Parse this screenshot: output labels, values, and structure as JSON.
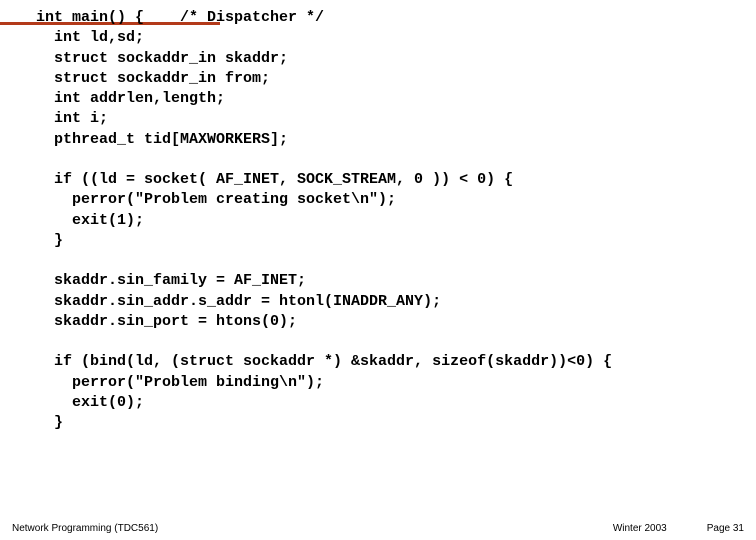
{
  "code": {
    "l1": "int main() {    /* Dispatcher */",
    "l2": "  int ld,sd;",
    "l3": "  struct sockaddr_in skaddr;",
    "l4": "  struct sockaddr_in from;",
    "l5": "  int addrlen,length;",
    "l6": "  int i;",
    "l7": "  pthread_t tid[MAXWORKERS];",
    "l8": "",
    "l9": "  if ((ld = socket( AF_INET, SOCK_STREAM, 0 )) < 0) {",
    "l10": "    perror(\"Problem creating socket\\n\");",
    "l11": "    exit(1);",
    "l12": "  }",
    "l13": "",
    "l14": "  skaddr.sin_family = AF_INET;",
    "l15": "  skaddr.sin_addr.s_addr = htonl(INADDR_ANY);",
    "l16": "  skaddr.sin_port = htons(0);",
    "l17": "",
    "l18": "  if (bind(ld, (struct sockaddr *) &skaddr, sizeof(skaddr))<0) {",
    "l19": "    perror(\"Problem binding\\n\");",
    "l20": "    exit(0);",
    "l21": "  }"
  },
  "footer": {
    "left": "Network Programming (TDC561)",
    "center": "Winter 2003",
    "right": "Page 31"
  }
}
